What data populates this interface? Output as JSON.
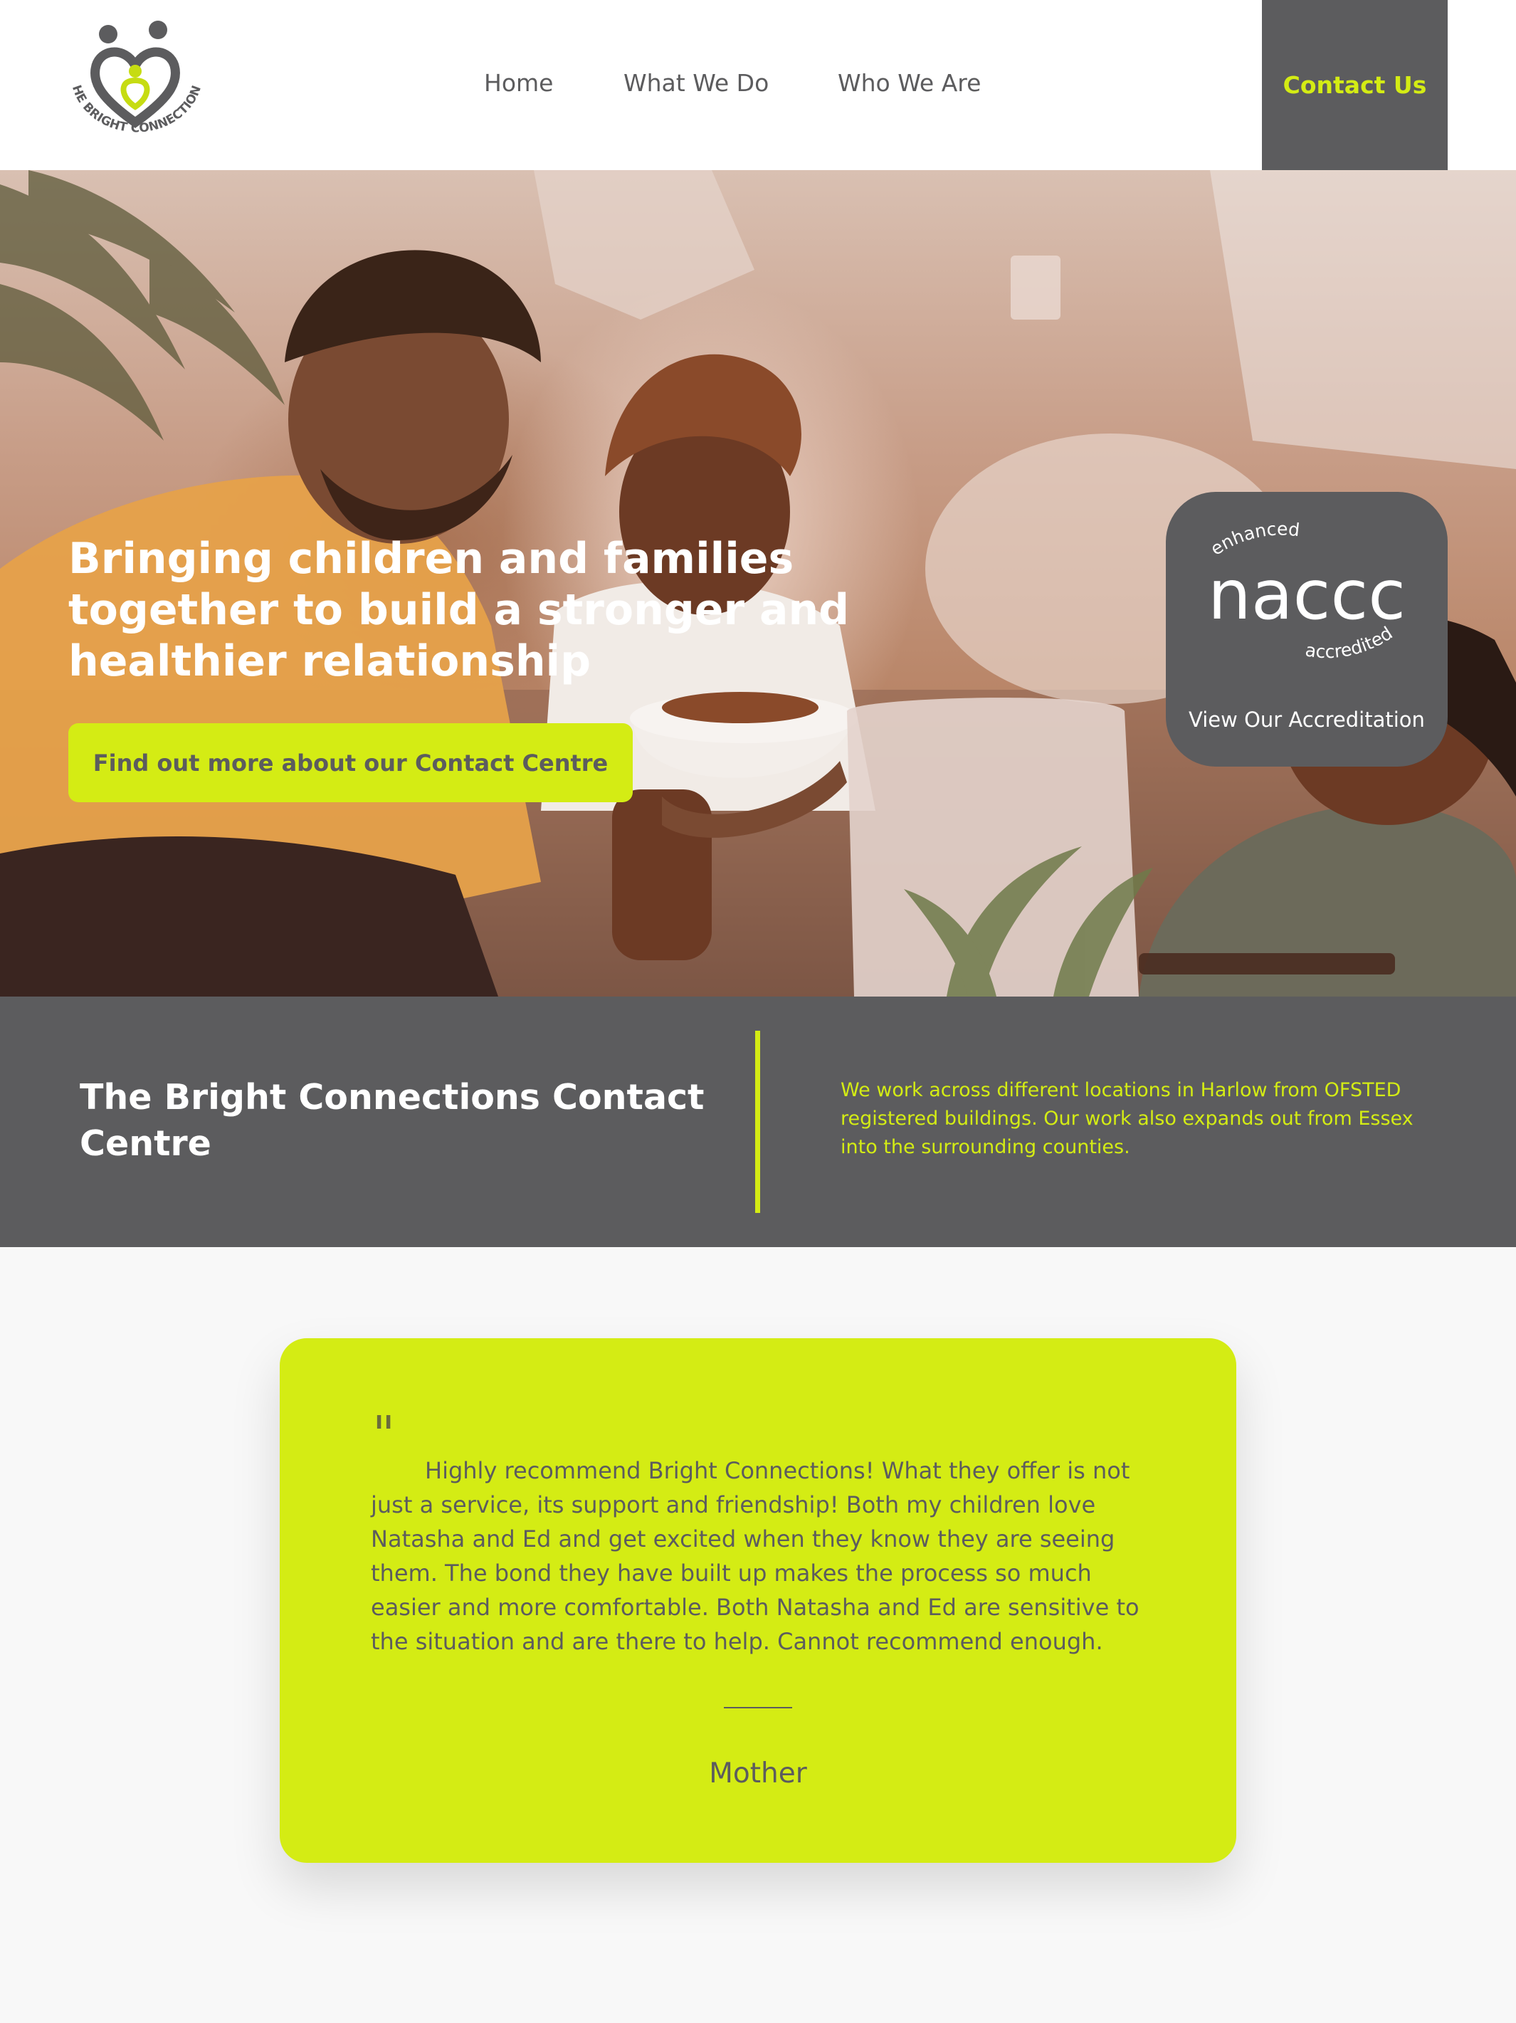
{
  "header": {
    "logo_text": "THE BRIGHT CONNECTIONS",
    "nav": [
      {
        "label": "Home"
      },
      {
        "label": "What We Do"
      },
      {
        "label": "Who We Are"
      }
    ],
    "contact_label": "Contact Us"
  },
  "hero": {
    "title": "Bringing children and families together to build a stronger and healthier relationship",
    "cta_label": "Find out more about our Contact Centre",
    "badge": {
      "top_text": "enhanced",
      "brand": "naccc",
      "bottom_text": "accredited",
      "link_label": "View Our Accreditation"
    }
  },
  "band": {
    "title": "The Bright Connections Contact Centre",
    "text": "We work across different locations in Harlow from OFSTED registered buildings. Our work also expands out from Essex into the surrounding counties."
  },
  "testimonial": {
    "quote_mark": "\"",
    "quote": "Highly recommend Bright Connections! What they offer is not just a service, its support and friendship! Both my children love Natasha and Ed and get excited when they know they are seeing them. The bond they have built up makes the process so much easier and more comfortable. Both Natasha and Ed are sensitive to the situation and are there to help. Cannot recommend enough.",
    "author": "Mother"
  },
  "colors": {
    "accent": "#d4ec14",
    "dark_gray": "#5c5c5e",
    "white": "#ffffff",
    "page_bg": "#f8f8f8"
  }
}
